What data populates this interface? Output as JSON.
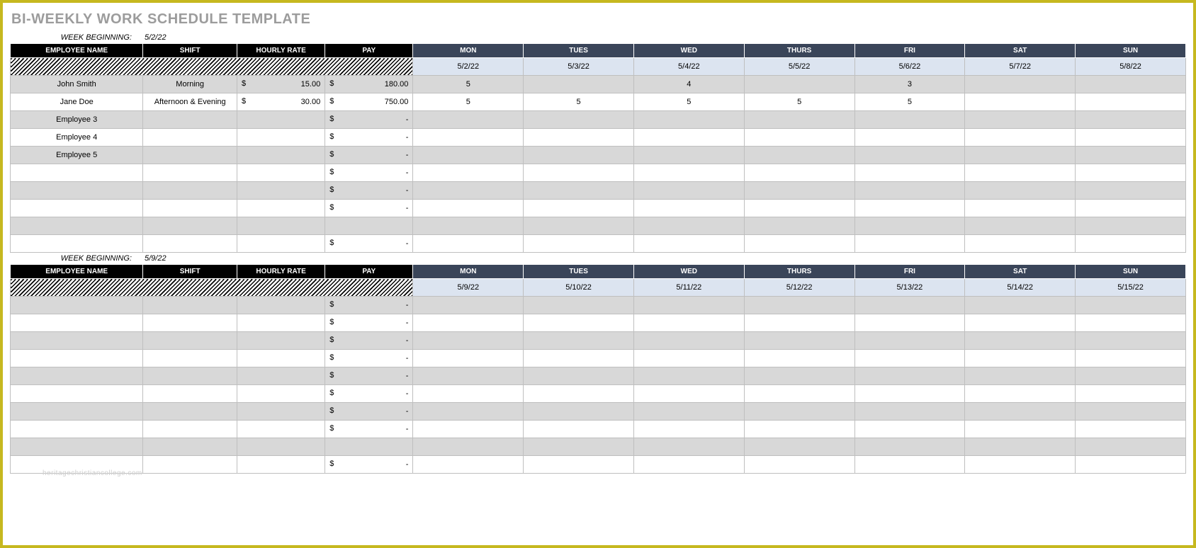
{
  "title": "BI-WEEKLY WORK SCHEDULE TEMPLATE",
  "labels": {
    "week_beginning": "WEEK BEGINNING:",
    "employee_name": "EMPLOYEE NAME",
    "shift": "SHIFT",
    "hourly_rate": "HOURLY RATE",
    "pay": "PAY",
    "days": [
      "MON",
      "TUES",
      "WED",
      "THURS",
      "FRI",
      "SAT",
      "SUN"
    ],
    "currency": "$",
    "dash": "-"
  },
  "weeks": [
    {
      "begin": "5/2/22",
      "dates": [
        "5/2/22",
        "5/3/22",
        "5/4/22",
        "5/5/22",
        "5/6/22",
        "5/7/22",
        "5/8/22"
      ],
      "rows": [
        {
          "name": "John Smith",
          "shift": "Morning",
          "rate": "15.00",
          "pay": "180.00",
          "d": [
            "5",
            "",
            "4",
            "",
            "3",
            "",
            ""
          ]
        },
        {
          "name": "Jane Doe",
          "shift": "Afternoon & Evening",
          "rate": "30.00",
          "pay": "750.00",
          "d": [
            "5",
            "5",
            "5",
            "5",
            "5",
            "",
            ""
          ]
        },
        {
          "name": "Employee 3",
          "shift": "",
          "rate": "",
          "pay": "-",
          "d": [
            "",
            "",
            "",
            "",
            "",
            "",
            ""
          ]
        },
        {
          "name": "Employee 4",
          "shift": "",
          "rate": "",
          "pay": "-",
          "d": [
            "",
            "",
            "",
            "",
            "",
            "",
            ""
          ]
        },
        {
          "name": "Employee 5",
          "shift": "",
          "rate": "",
          "pay": "-",
          "d": [
            "",
            "",
            "",
            "",
            "",
            "",
            ""
          ]
        },
        {
          "name": "",
          "shift": "",
          "rate": "",
          "pay": "-",
          "d": [
            "",
            "",
            "",
            "",
            "",
            "",
            ""
          ]
        },
        {
          "name": "",
          "shift": "",
          "rate": "",
          "pay": "-",
          "d": [
            "",
            "",
            "",
            "",
            "",
            "",
            ""
          ]
        },
        {
          "name": "",
          "shift": "",
          "rate": "",
          "pay": "-",
          "d": [
            "",
            "",
            "",
            "",
            "",
            "",
            ""
          ]
        },
        {
          "name": "",
          "shift": "",
          "rate": "",
          "pay": "",
          "d": [
            "",
            "",
            "",
            "",
            "",
            "",
            ""
          ]
        },
        {
          "name": "",
          "shift": "",
          "rate": "",
          "pay": "-",
          "d": [
            "",
            "",
            "",
            "",
            "",
            "",
            ""
          ]
        }
      ]
    },
    {
      "begin": "5/9/22",
      "dates": [
        "5/9/22",
        "5/10/22",
        "5/11/22",
        "5/12/22",
        "5/13/22",
        "5/14/22",
        "5/15/22"
      ],
      "rows": [
        {
          "name": "",
          "shift": "",
          "rate": "",
          "pay": "-",
          "d": [
            "",
            "",
            "",
            "",
            "",
            "",
            ""
          ]
        },
        {
          "name": "",
          "shift": "",
          "rate": "",
          "pay": "-",
          "d": [
            "",
            "",
            "",
            "",
            "",
            "",
            ""
          ]
        },
        {
          "name": "",
          "shift": "",
          "rate": "",
          "pay": "-",
          "d": [
            "",
            "",
            "",
            "",
            "",
            "",
            ""
          ]
        },
        {
          "name": "",
          "shift": "",
          "rate": "",
          "pay": "-",
          "d": [
            "",
            "",
            "",
            "",
            "",
            "",
            ""
          ]
        },
        {
          "name": "",
          "shift": "",
          "rate": "",
          "pay": "-",
          "d": [
            "",
            "",
            "",
            "",
            "",
            "",
            ""
          ]
        },
        {
          "name": "",
          "shift": "",
          "rate": "",
          "pay": "-",
          "d": [
            "",
            "",
            "",
            "",
            "",
            "",
            ""
          ]
        },
        {
          "name": "",
          "shift": "",
          "rate": "",
          "pay": "-",
          "d": [
            "",
            "",
            "",
            "",
            "",
            "",
            ""
          ]
        },
        {
          "name": "",
          "shift": "",
          "rate": "",
          "pay": "-",
          "d": [
            "",
            "",
            "",
            "",
            "",
            "",
            ""
          ]
        },
        {
          "name": "",
          "shift": "",
          "rate": "",
          "pay": "",
          "d": [
            "",
            "",
            "",
            "",
            "",
            "",
            ""
          ]
        },
        {
          "name": "",
          "shift": "",
          "rate": "",
          "pay": "-",
          "d": [
            "",
            "",
            "",
            "",
            "",
            "",
            ""
          ]
        }
      ]
    }
  ],
  "watermark": "heritagechristiancollege.com"
}
